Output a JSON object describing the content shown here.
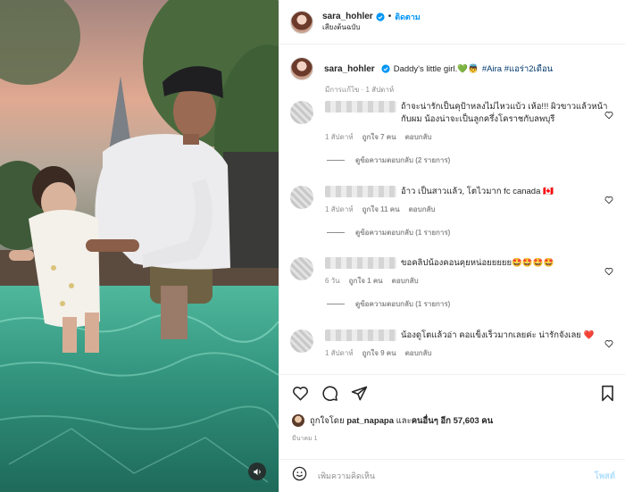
{
  "header": {
    "username": "sara_hohler",
    "separator": "•",
    "follow_label": "ติดตาม",
    "audio": "เสียงต้นฉบับ"
  },
  "caption": {
    "username": "sara_hohler",
    "text": "Daddy's little girl.💚👼",
    "hashtags": "#Aira #แอร่า2เดือน",
    "meta": "มีการแก้ไข · 1 สัปดาห์"
  },
  "comments": [
    {
      "text": "ถ้าจะน่ารักเป็นคุป้าหลงไม่ไหวแบ้ว เห้อ!!! ผิวขาวแล้วหน้ากับผม น้องน่าจะเป็นลูกครึ่งโคราชกับลพบุรี",
      "time": "1 สัปดาห์",
      "likes": "ถูกใจ 7 คน",
      "reply": "ตอบกลับ",
      "view_replies": "ดูข้อความตอบกลับ (2 รายการ)"
    },
    {
      "text": "อ้าว เป็นสาวแล้ว, โตไวมาก fc canada 🇨🇦",
      "time": "1 สัปดาห์",
      "likes": "ถูกใจ 11 คน",
      "reply": "ตอบกลับ",
      "view_replies": "ดูข้อความตอบกลับ (1 รายการ)"
    },
    {
      "text": "ขอคลิปน้องคอนคุยหน่อยยยยย🤩🤩🤩🤩",
      "time": "6 วัน",
      "likes": "ถูกใจ 1 คน",
      "reply": "ตอบกลับ",
      "view_replies": "ดูข้อความตอบกลับ (1 รายการ)"
    },
    {
      "text": "น้องดูโตแล้วอ่า คอแข็งเร็วมากเลยค่ะ น่ารักจังเลย ❤️",
      "time": "1 สัปดาห์",
      "likes": "ถูกใจ 9 คน",
      "reply": "ตอบกลับ"
    }
  ],
  "likes": {
    "prefix": "ถูกใจโดย",
    "user": "pat_napapa",
    "middle": "และ",
    "others": "คนอื่นๆ อีก 57,603 คน"
  },
  "date": "มีนาคม 1",
  "add_comment": {
    "placeholder": "เพิ่มความคิดเห็น",
    "post_label": "โพสต์"
  },
  "icons": {
    "verified": "verified-badge-icon",
    "heart": "heart-icon",
    "comment": "comment-icon",
    "share": "share-icon",
    "save": "bookmark-icon",
    "emoji": "emoji-icon",
    "audio": "speaker-icon"
  },
  "colors": {
    "accent": "#0095f6",
    "hashtag": "#00376b",
    "muted": "#8e8e8e",
    "pool": "#2f9e86"
  }
}
